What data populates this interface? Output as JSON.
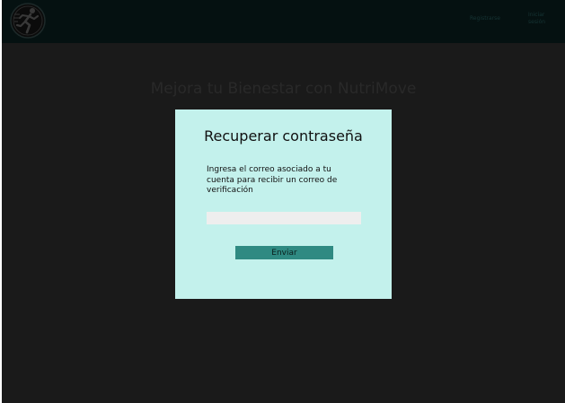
{
  "header": {
    "logo_icon": "running-person-logo-icon",
    "nav_register": "Registrarse",
    "nav_login": "Iniciar sesión"
  },
  "hero": {
    "title": "Mejora tu Bienestar con NutriMove"
  },
  "modal": {
    "title": "Recuperar contraseña",
    "description": "Ingresa el correo asociado a tu cuenta para recibir un correo de verificación",
    "email_value": "",
    "email_placeholder": "",
    "send_label": "Enviar"
  },
  "colors": {
    "page_background": "#1b1b1b",
    "header_background": "#061212",
    "modal_background": "#c3f1ec",
    "button_background": "#2f8a82",
    "input_background": "#eeeeee"
  }
}
